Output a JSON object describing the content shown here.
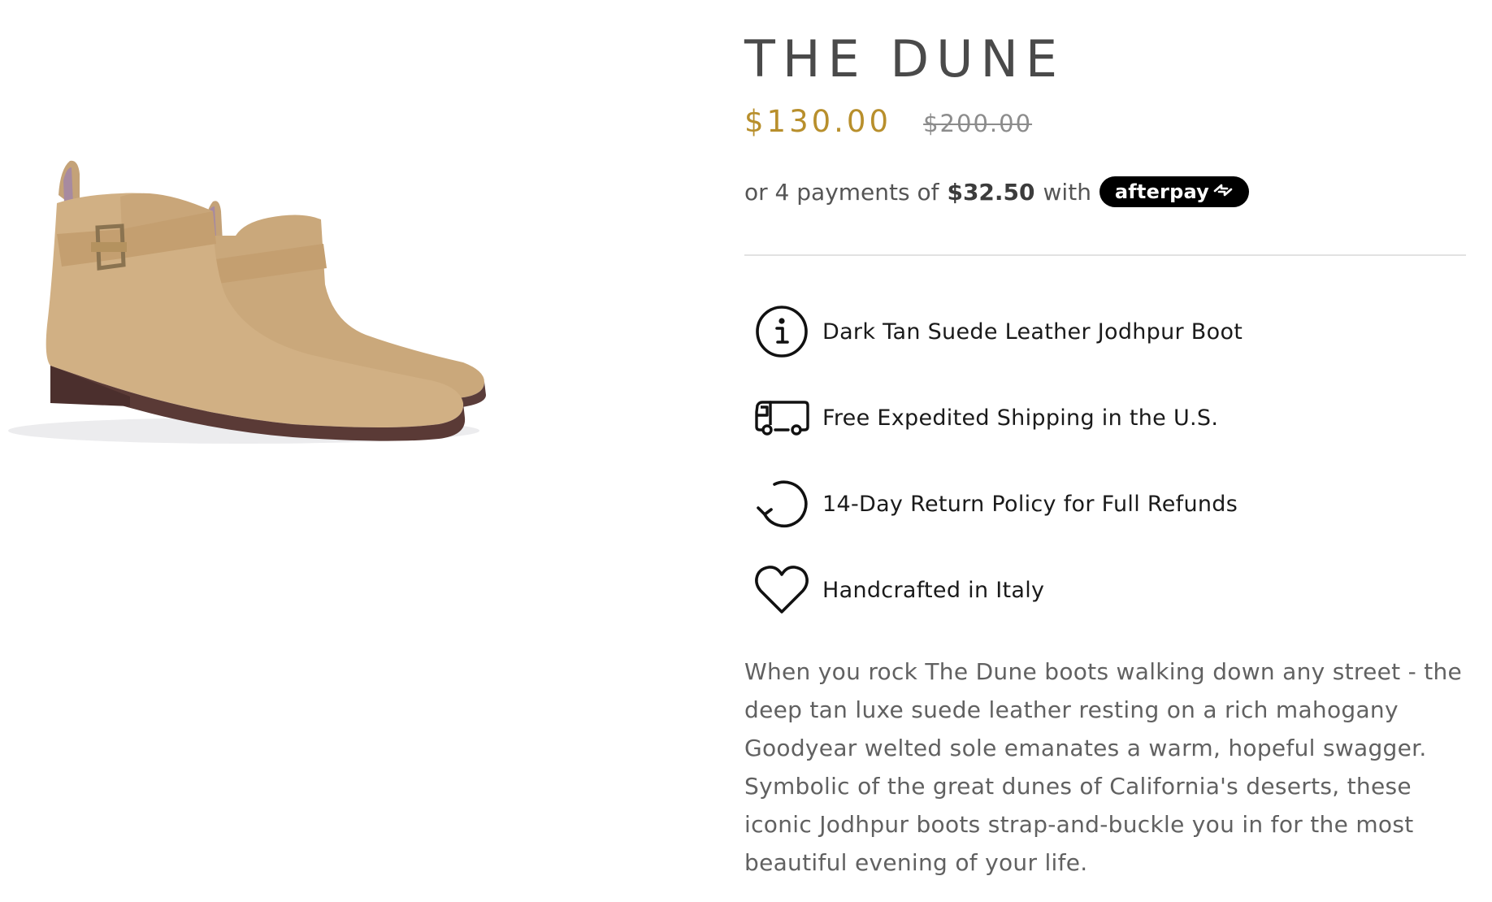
{
  "product": {
    "title": "THE DUNE",
    "image_alt": "Dark tan suede jodhpur boots",
    "price": {
      "sale": "$130.00",
      "compare_at": "$200.00",
      "sale_color": "#b88f2c"
    },
    "afterpay": {
      "prefix": "or 4 payments of",
      "amount": "$32.50",
      "suffix": "with",
      "badge_text": "afterpay",
      "badge_icon": "afterpay-arrows-icon"
    },
    "features": [
      {
        "icon": "info-circle-icon",
        "label": "Dark Tan Suede Leather Jodhpur Boot"
      },
      {
        "icon": "delivery-truck-icon",
        "label": "Free Expedited Shipping in the U.S."
      },
      {
        "icon": "return-arrow-icon",
        "label": "14-Day Return Policy for Full Refunds"
      },
      {
        "icon": "heart-icon",
        "label": "Handcrafted in Italy"
      }
    ],
    "description": "When you rock The Dune boots walking down any street - the deep tan luxe suede leather resting on a rich mahogany Goodyear welted sole emanates a warm, hopeful swagger. Symbolic of the great dunes of California's deserts, these iconic Jodhpur boots strap-and-buckle you in for the most beautiful evening of your life."
  }
}
